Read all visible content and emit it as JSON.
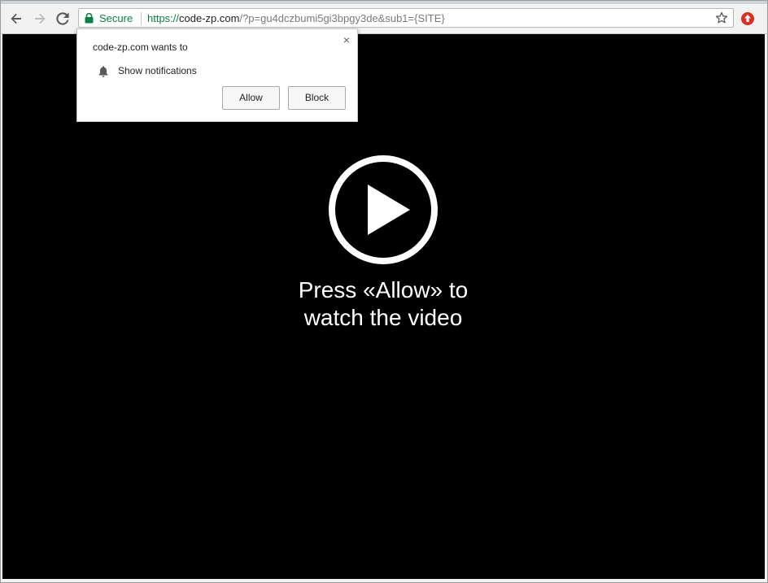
{
  "browser": {
    "security_label": "Secure",
    "url": {
      "scheme": "https://",
      "host": "code-zp.com",
      "rest": "/?p=gu4dczbumi5gi3bpgy3de&sub1={SITE}"
    },
    "icons": {
      "back": "back-arrow-icon",
      "forward": "forward-arrow-icon",
      "reload": "reload-icon",
      "lock": "lock-icon",
      "bookmark": "star-icon",
      "extension": "extension-icon"
    },
    "colors": {
      "secure_green": "#0b8043",
      "extension_red": "#d93025"
    }
  },
  "notification_prompt": {
    "title": "code-zp.com wants to",
    "permission": "Show notifications",
    "allow_label": "Allow",
    "block_label": "Block",
    "close_symbol": "×",
    "icon": "bell-icon"
  },
  "page": {
    "message_line1": "Press «Allow» to",
    "message_line2": "watch the video",
    "icon": "play-icon",
    "background": "#000000"
  }
}
